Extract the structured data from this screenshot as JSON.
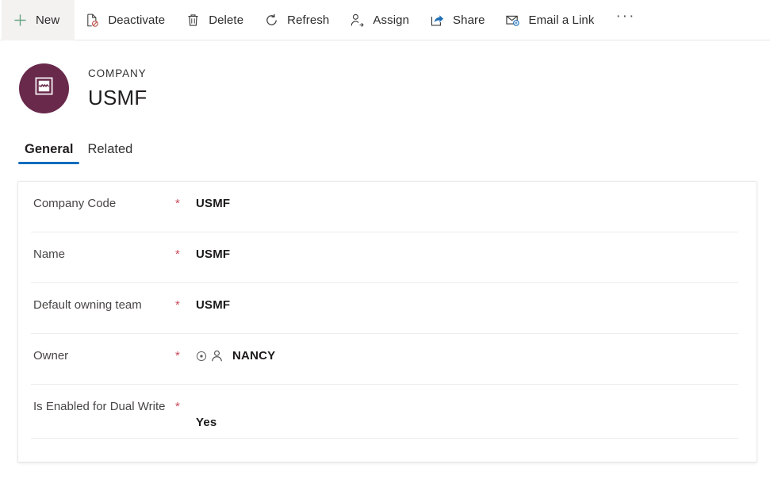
{
  "commandbar": {
    "items": [
      {
        "label": "New",
        "icon": "plus-icon",
        "name": "new"
      },
      {
        "label": "Deactivate",
        "icon": "deactivate-icon",
        "name": "deactivate"
      },
      {
        "label": "Delete",
        "icon": "trash-icon",
        "name": "delete"
      },
      {
        "label": "Refresh",
        "icon": "refresh-icon",
        "name": "refresh"
      },
      {
        "label": "Assign",
        "icon": "assign-person-icon",
        "name": "assign"
      },
      {
        "label": "Share",
        "icon": "share-icon",
        "name": "share"
      },
      {
        "label": "Email a Link",
        "icon": "email-link-icon",
        "name": "email-a-link"
      }
    ],
    "overflow_label": "···"
  },
  "record_header": {
    "kicker": "COMPANY",
    "title": "USMF",
    "avatar_icon": "company-entity-icon",
    "avatar_color": "#69294B"
  },
  "tabs": [
    {
      "label": "General",
      "active": true
    },
    {
      "label": "Related",
      "active": false
    }
  ],
  "form": {
    "required_marker": "*",
    "rows": [
      {
        "label": "Company Code",
        "value": "USMF",
        "required": true,
        "icons": []
      },
      {
        "label": "Name",
        "value": "USMF",
        "required": true,
        "icons": []
      },
      {
        "label": "Default owning team",
        "value": "USMF",
        "required": true,
        "icons": []
      },
      {
        "label": "Owner",
        "value": "NANCY",
        "required": true,
        "icons": [
          "record-status-icon",
          "person-icon"
        ]
      },
      {
        "label": "Is Enabled for Dual Write",
        "value": "Yes",
        "required": true,
        "icons": []
      }
    ]
  },
  "colors": {
    "accent_tab": "#0F6CBD",
    "required_asterisk": "#C84C5A",
    "new_plus": "#6BA583",
    "avatar": "#69294B"
  }
}
